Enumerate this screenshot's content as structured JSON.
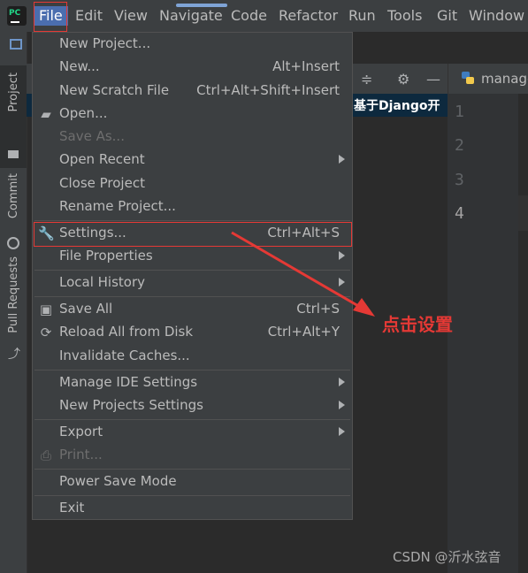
{
  "menubar": {
    "items": [
      {
        "label": "File",
        "mnemonic": "F"
      },
      {
        "label": "Edit",
        "mnemonic": "E"
      },
      {
        "label": "View",
        "mnemonic": "V"
      },
      {
        "label": "Navigate",
        "mnemonic": "N"
      },
      {
        "label": "Code",
        "mnemonic": "C"
      },
      {
        "label": "Refactor",
        "mnemonic": "R"
      },
      {
        "label": "Run",
        "mnemonic": "u"
      },
      {
        "label": "Tools",
        "mnemonic": "T"
      },
      {
        "label": "Git",
        "mnemonic": "G"
      },
      {
        "label": "Window",
        "mnemonic": "W"
      }
    ]
  },
  "toolstrip": {
    "project": "Project",
    "commit": "Commit",
    "pull_requests": "Pull Requests"
  },
  "project_panel": {
    "selected_row": "基于Django开"
  },
  "editor": {
    "tab_label": "manage",
    "line_numbers": [
      "1",
      "2",
      "3",
      "4"
    ]
  },
  "file_menu": {
    "new_project": "New Project...",
    "new": "New...",
    "new_shortcut": "Alt+Insert",
    "new_scratch": "New Scratch File",
    "new_scratch_shortcut": "Ctrl+Alt+Shift+Insert",
    "open": "Open...",
    "save_as": "Save As...",
    "open_recent": "Open Recent",
    "close_project": "Close Project",
    "rename_project": "Rename Project...",
    "settings": "Settings...",
    "settings_shortcut": "Ctrl+Alt+S",
    "file_properties": "File Properties",
    "local_history": "Local History",
    "save_all": "Save All",
    "save_all_shortcut": "Ctrl+S",
    "reload_all": "Reload All from Disk",
    "reload_all_shortcut": "Ctrl+Alt+Y",
    "invalidate_caches": "Invalidate Caches...",
    "manage_ide_settings": "Manage IDE Settings",
    "new_projects_settings": "New Projects Settings",
    "export": "Export",
    "print": "Print...",
    "power_save_mode": "Power Save Mode",
    "exit": "Exit"
  },
  "annotation": {
    "text": "点击设置",
    "color": "#e53935"
  },
  "watermark": "CSDN @沂水弦音",
  "colors": {
    "menu_bg": "#3c3f41",
    "editor_bg": "#2b2b2b",
    "selection": "#4b6eaf",
    "highlight_box": "#e53935"
  }
}
